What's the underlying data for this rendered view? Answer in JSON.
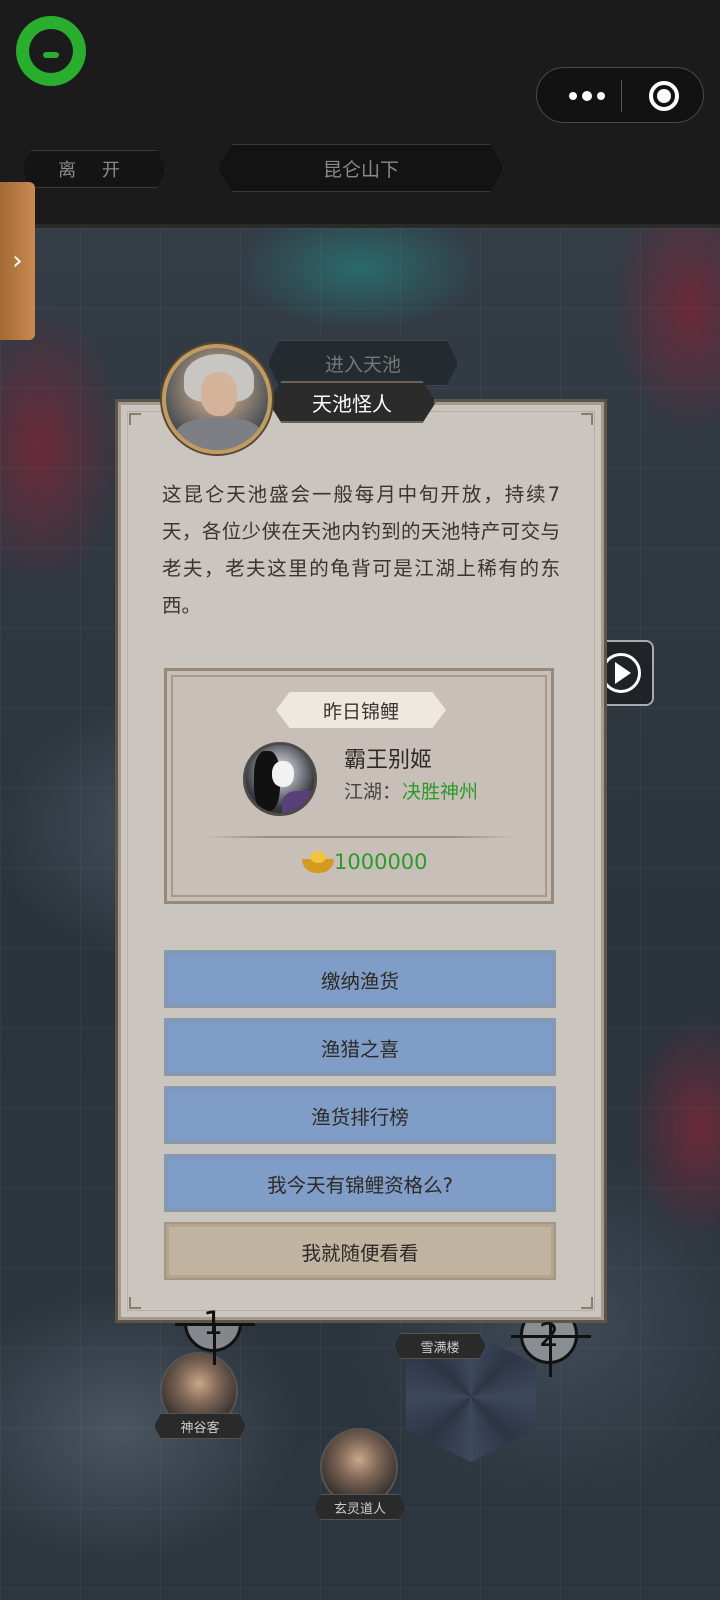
{
  "header": {
    "leave_label": "离 开",
    "location_title": "昆仑山下"
  },
  "map": {
    "enter_pool_label": "进入天池",
    "markers": [
      {
        "number": "1"
      },
      {
        "number": "2"
      }
    ],
    "npcs": [
      {
        "name": "神谷客"
      },
      {
        "name": "雪满楼"
      },
      {
        "name": "玄灵道人"
      }
    ]
  },
  "dialog": {
    "speaker_name": "天池怪人",
    "text": "这昆仑天池盛会一般每月中旬开放，持续7天，各位少侠在天池内钓到的天池特产可交与老夫，老夫这里的龟背可是江湖上稀有的东西。",
    "koi": {
      "label": "昨日锦鲤",
      "player_name": "霸王别姬",
      "guild_label": "江湖：",
      "guild_name": "决胜神州",
      "reward": "1000000"
    },
    "options": [
      {
        "label": "缴纳渔货"
      },
      {
        "label": "渔猎之喜"
      },
      {
        "label": "渔货排行榜"
      },
      {
        "label": "我今天有锦鲤资格么?"
      },
      {
        "label": "我就随便看看"
      }
    ]
  },
  "colors": {
    "accent_green": "#2aae2e",
    "guild_green": "#2a9a2a",
    "option_blue": "#7f9dc7",
    "option_plain": "#c0b3a0"
  },
  "icons": {
    "app": "chat-bubble-icon",
    "more": "more-dots-icon",
    "close": "target-close-icon",
    "side_tab": "chevron-right-icon",
    "video": "play-icon",
    "currency": "gold-ingot-icon"
  }
}
